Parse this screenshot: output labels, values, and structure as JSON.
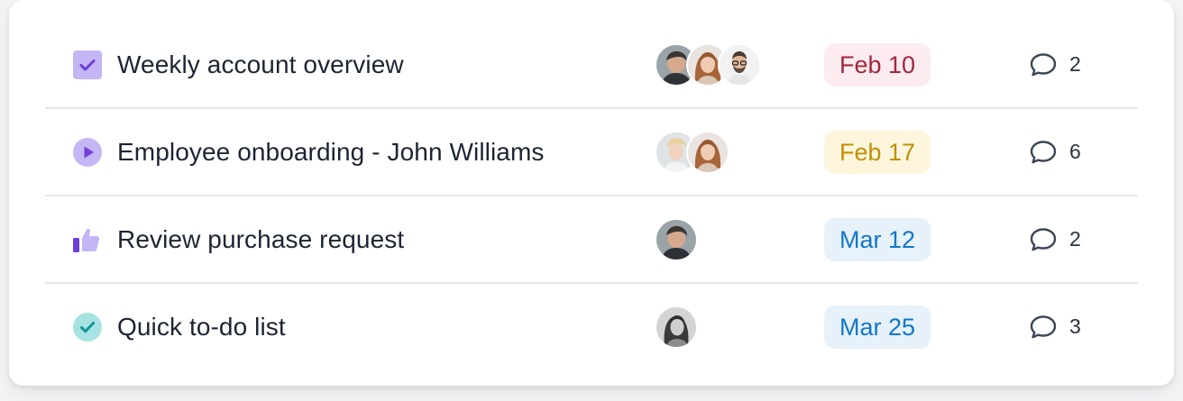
{
  "tasks": [
    {
      "title": "Weekly account overview",
      "status_icon": "purple-checkbox-icon",
      "avatars": [
        "avatar-man-dark-hair",
        "avatar-woman-auburn-hair",
        "avatar-man-glasses-beard"
      ],
      "due": "Feb 10",
      "due_color": "#a3263d",
      "comments": "2"
    },
    {
      "title": "Employee onboarding - John Williams",
      "status_icon": "play-circle-icon",
      "avatars": [
        "avatar-man-blond",
        "avatar-woman-auburn-hair"
      ],
      "due": "Feb 17",
      "due_color": "#c18f00",
      "comments": "6"
    },
    {
      "title": "Review purchase request",
      "status_icon": "thumbs-up-icon",
      "avatars": [
        "avatar-man-dark-hair"
      ],
      "due": "Mar 12",
      "due_color": "#1177c9",
      "comments": "2"
    },
    {
      "title": "Quick to-do list",
      "status_icon": "teal-check-circle-icon",
      "avatars": [
        "avatar-woman-grayscale"
      ],
      "due": "Mar 25",
      "due_color": "#1177c9",
      "comments": "3"
    }
  ],
  "colors": {
    "purple_accent": "#8b5cf6",
    "purple_light": "#c4b5f5",
    "teal": "#17a2a8",
    "divider": "#e6e7ea"
  }
}
